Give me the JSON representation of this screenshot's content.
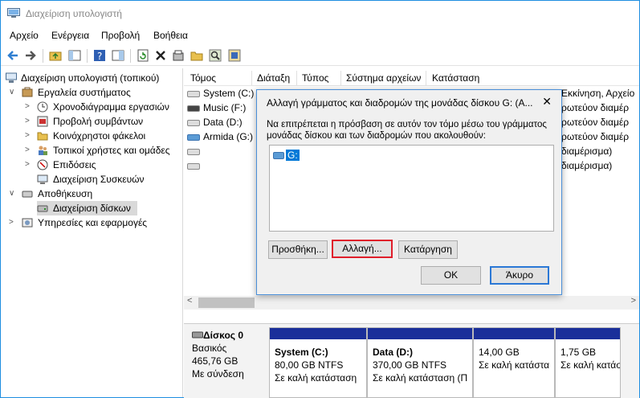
{
  "window": {
    "title": "Διαχείριση υπολογιστή"
  },
  "menu": [
    "Αρχείο",
    "Ενέργεια",
    "Προβολή",
    "Βοήθεια"
  ],
  "tree": [
    {
      "label": "Διαχείριση υπολογιστή (τοπικού)"
    },
    {
      "label": "Εργαλεία συστήματος"
    },
    {
      "label": "Χρονοδιάγραμμα εργασιών"
    },
    {
      "label": "Προβολή συμβάντων"
    },
    {
      "label": "Κοινόχρηστοι φάκελοι"
    },
    {
      "label": "Τοπικοί χρήστες και ομάδες"
    },
    {
      "label": "Επιδόσεις"
    },
    {
      "label": "Διαχείριση Συσκευών"
    },
    {
      "label": "Αποθήκευση"
    },
    {
      "label": "Διαχείριση δίσκων"
    },
    {
      "label": "Υπηρεσίες και εφαρμογές"
    }
  ],
  "columns": [
    "Τόμος",
    "Διάταξη",
    "Τύπος",
    "Σύστημα αρχείων",
    "Κατάσταση"
  ],
  "volumes": [
    "System (C:)",
    "Music (F:)",
    "Data (D:)",
    "Armida (G:)",
    "",
    ""
  ],
  "statuses": [
    "Εκκίνηση, Αρχείο",
    "ρωτεύον διαμέρ",
    "ρωτεύον διαμέρ",
    "ρωτεύον διαμέρ",
    "διαμέρισμα)",
    "διαμέρισμα)"
  ],
  "disk": {
    "name": "Δίσκος 0",
    "type": "Βασικός",
    "size": "465,76 GB",
    "state": "Με σύνδεση",
    "partitions": [
      {
        "name": "System  (C:)",
        "size": "80,00 GB NTFS",
        "status": "Σε καλή κατάσταση"
      },
      {
        "name": "Data  (D:)",
        "size": "370,00 GB NTFS",
        "status": "Σε καλή κατάσταση (Π"
      },
      {
        "name": "",
        "size": "14,00 GB",
        "status": "Σε καλή κατάστα"
      },
      {
        "name": "",
        "size": "1,75 GB",
        "status": "Σε καλή κατάστ"
      }
    ]
  },
  "dialog": {
    "title": "Αλλαγή γράμματος και διαδρομών της μονάδας δίσκου G: (A...",
    "text": "Να επιτρέπεται η πρόσβαση σε αυτόν τον τόμο μέσω του γράμματος μονάδας δίσκου και των διαδρομών που ακολουθούν:",
    "item": "G:",
    "add": "Προσθήκη...",
    "change": "Αλλαγή...",
    "remove": "Κατάργηση",
    "ok": "OK",
    "cancel": "Άκυρο",
    "close": "✕"
  }
}
